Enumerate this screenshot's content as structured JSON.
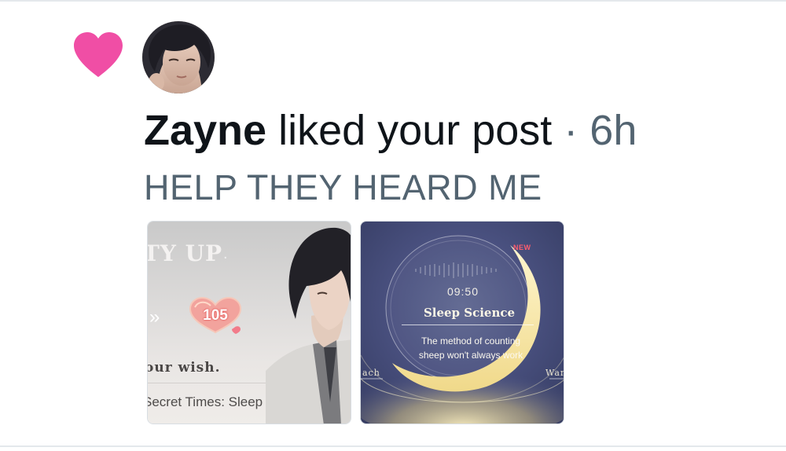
{
  "notification": {
    "user_name": "Zayne",
    "action_text": "liked your post",
    "separator": "·",
    "time_ago": "6h",
    "post_text": "HELP THEY HEARD ME"
  },
  "media": [
    {
      "title_fragment": "TY UP",
      "dot": ".",
      "arrows": "»",
      "badge_value": "105",
      "wish_text": "our wish.",
      "caption": "Secret Times: Sleep Science"
    },
    {
      "new_badge": "NEW",
      "time": "09:50",
      "title": "Sleep Science",
      "description": "The method of counting sheep won't always work",
      "left_label": "ach",
      "right_label": "War"
    }
  ],
  "colors": {
    "heart": "#f04ea5",
    "muted_text": "#536471",
    "primary_text": "#0f1419"
  },
  "icons": {
    "heart": "heart-icon"
  }
}
